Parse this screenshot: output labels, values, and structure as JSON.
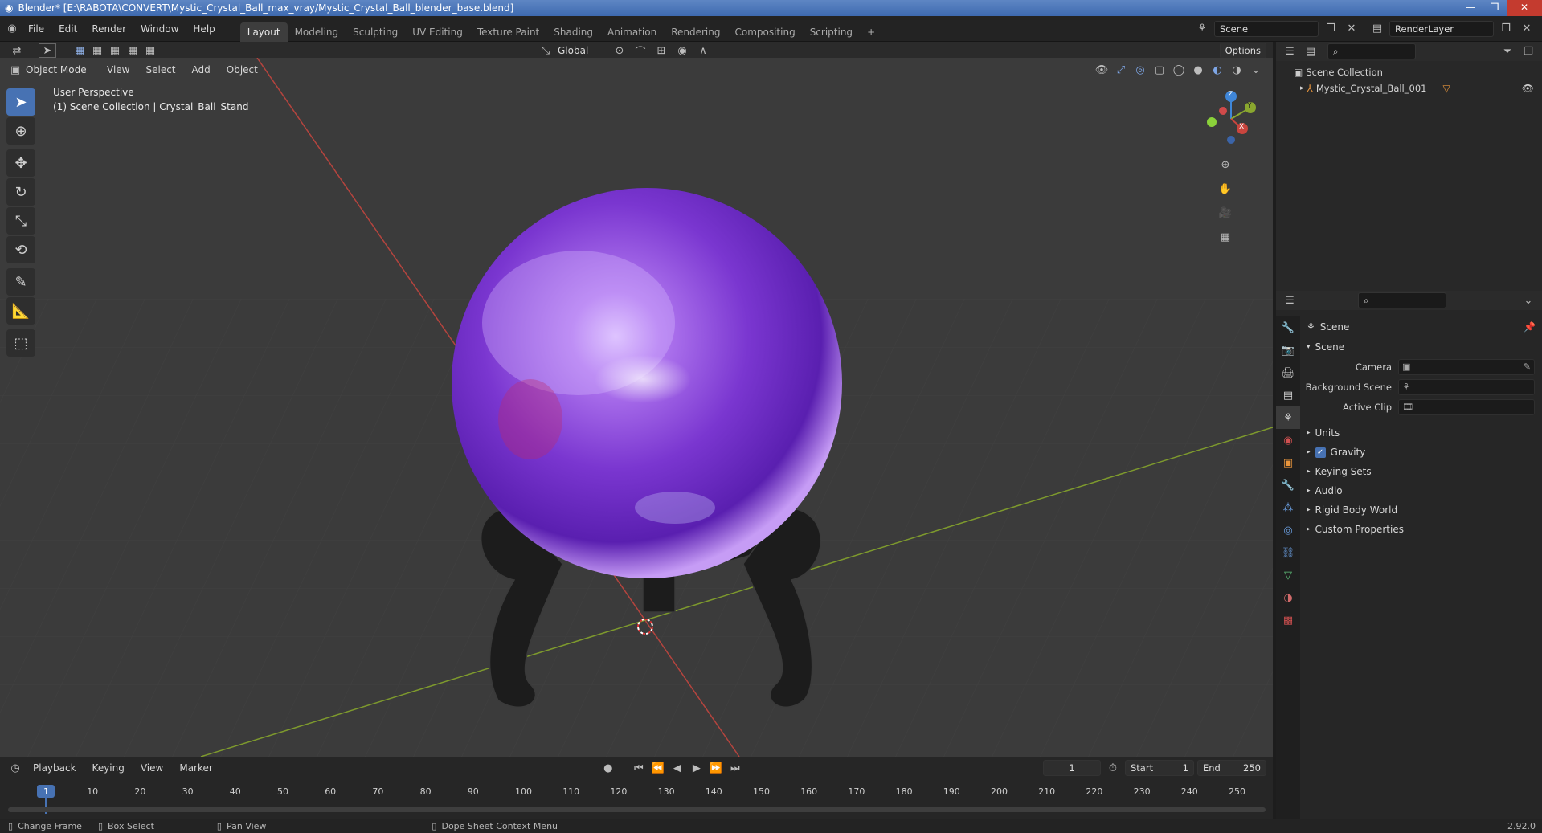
{
  "window": {
    "title": "Blender* [E:\\RABOTA\\CONVERT\\Mystic_Crystal_Ball_max_vray/Mystic_Crystal_Ball_blender_base.blend]"
  },
  "menus": [
    "File",
    "Edit",
    "Render",
    "Window",
    "Help"
  ],
  "workspaces": [
    "Layout",
    "Modeling",
    "Sculpting",
    "UV Editing",
    "Texture Paint",
    "Shading",
    "Animation",
    "Rendering",
    "Compositing",
    "Scripting"
  ],
  "active_workspace": "Layout",
  "scene_field": "Scene",
  "view_layer_field": "RenderLayer",
  "toolbar": {
    "transform_orientation": "Global",
    "options": "Options"
  },
  "viewport_header": {
    "mode": "Object Mode",
    "menus": [
      "View",
      "Select",
      "Add",
      "Object"
    ]
  },
  "viewport_overlay": {
    "line1": "User Perspective",
    "line2": "(1) Scene Collection | Crystal_Ball_Stand"
  },
  "gizmo": {
    "x": "X",
    "y": "Y",
    "z": "Z"
  },
  "outliner": {
    "root": "Scene Collection",
    "items": [
      "Mystic_Crystal_Ball_001"
    ]
  },
  "properties": {
    "context": "Scene",
    "panel_title": "Scene",
    "fields": [
      {
        "label": "Camera"
      },
      {
        "label": "Background Scene"
      },
      {
        "label": "Active Clip"
      }
    ],
    "subpanels": [
      "Units",
      "Gravity",
      "Keying Sets",
      "Audio",
      "Rigid Body World",
      "Custom Properties"
    ],
    "gravity_checked": true
  },
  "timeline": {
    "menus": [
      "Playback",
      "Keying",
      "View",
      "Marker"
    ],
    "current_frame": "1",
    "start_label": "Start",
    "start": "1",
    "end_label": "End",
    "end": "250",
    "ticks": [
      "1",
      "10",
      "20",
      "30",
      "40",
      "50",
      "60",
      "70",
      "80",
      "90",
      "100",
      "110",
      "120",
      "130",
      "140",
      "150",
      "160",
      "170",
      "180",
      "190",
      "200",
      "210",
      "220",
      "230",
      "240",
      "250"
    ]
  },
  "statusbar": {
    "items": [
      "Change Frame",
      "Box Select",
      "Pan View",
      "Dope Sheet Context Menu"
    ],
    "version": "2.92.0"
  },
  "colors": {
    "accent": "#4772b3",
    "viewport_bg": "#3b3b3b",
    "ball": "#8a3fd6",
    "x_axis": "#c9453e",
    "y_axis": "#8aa72f",
    "z_axis": "#3f86d8"
  }
}
